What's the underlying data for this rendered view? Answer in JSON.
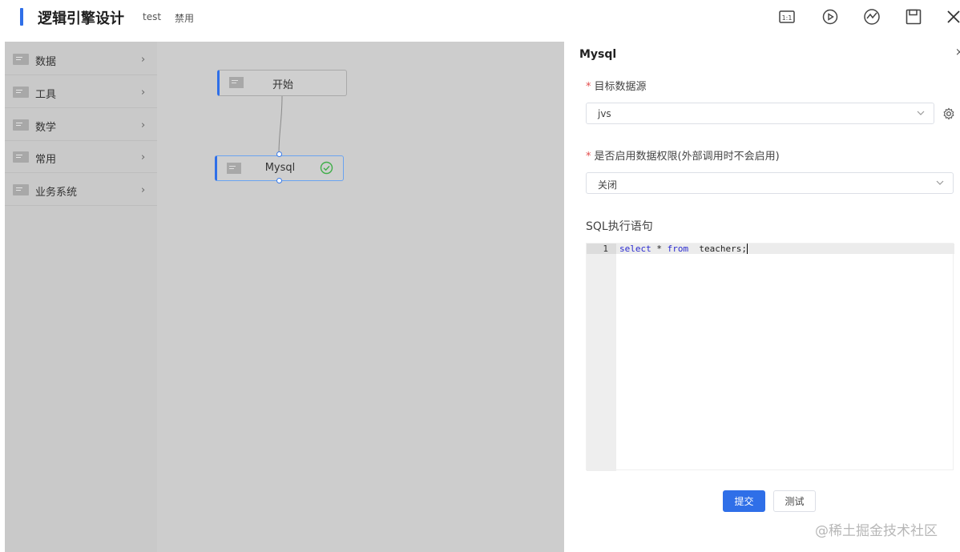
{
  "header": {
    "title": "逻辑引擎设计",
    "name": "test",
    "status": "禁用",
    "icons": [
      "fit-view-icon",
      "play-icon",
      "debug-icon",
      "save-icon",
      "close-icon"
    ]
  },
  "sidebar": {
    "items": [
      {
        "label": "数据"
      },
      {
        "label": "工具"
      },
      {
        "label": "数学"
      },
      {
        "label": "常用"
      },
      {
        "label": "业务系统"
      }
    ]
  },
  "canvas": {
    "nodes": [
      {
        "label": "开始"
      },
      {
        "label": "Mysql",
        "status": "ok"
      }
    ]
  },
  "panel": {
    "title": "Mysql",
    "close": "×",
    "datasource_label": "目标数据源",
    "datasource_value": "jvs",
    "permission_label": "是否启用数据权限(外部调用时不会启用)",
    "permission_value": "关闭",
    "sql_label": "SQL执行语句",
    "sql": {
      "line_number": "1",
      "kw1": "select",
      "star": " * ",
      "kw2": "from",
      "rest": "  teachers;"
    },
    "submit": "提交",
    "test": "测试"
  },
  "watermark": "@稀土掘金技术社区",
  "colors": {
    "accent": "#2f6fe8",
    "success": "#3fae49",
    "required": "#e34d4d"
  }
}
